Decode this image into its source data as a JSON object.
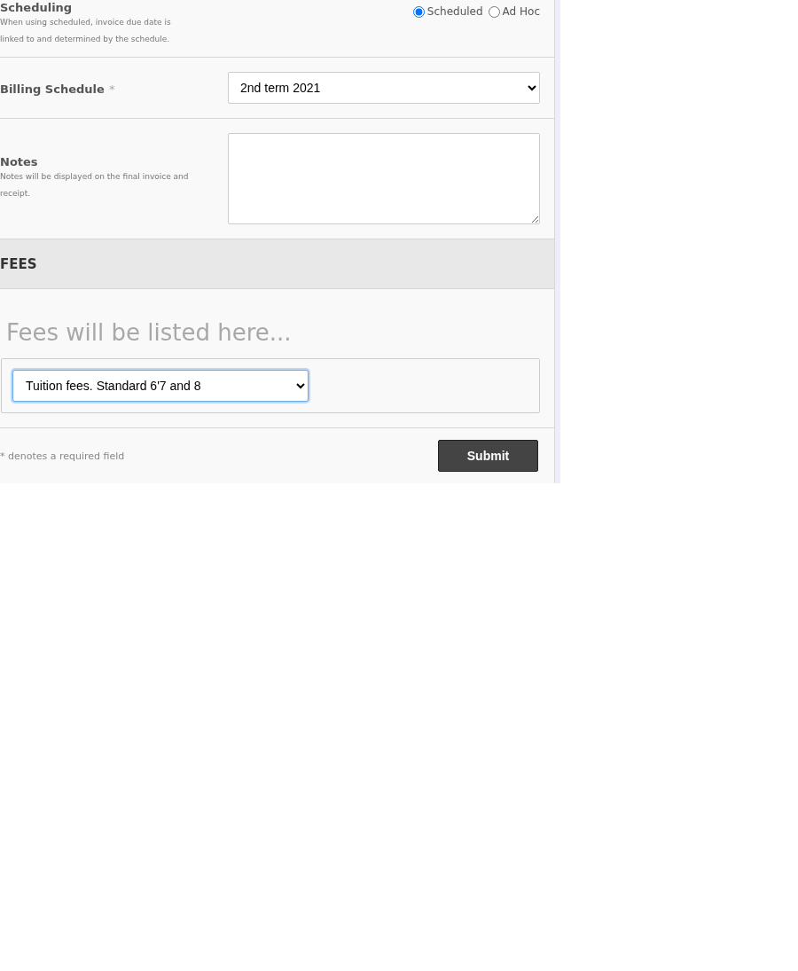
{
  "scheduling": {
    "label": "Scheduling",
    "help": "When using scheduled, invoice due date is linked to and determined by the schedule.",
    "options": [
      {
        "label": "Scheduled",
        "selected": true
      },
      {
        "label": "Ad Hoc",
        "selected": false
      }
    ]
  },
  "billing_schedule": {
    "label": "Billing Schedule",
    "required_mark": "*",
    "value": "2nd term 2021"
  },
  "notes": {
    "label": "Notes",
    "help": "Notes will be displayed on the final invoice and receipt."
  },
  "fees": {
    "title": "FEES",
    "placeholder": "Fees will be listed here...",
    "fee_select": {
      "value": "Tuition fees. Standard 6'7 and 8",
      "focused": true
    }
  },
  "footer": {
    "note": "* denotes a required field",
    "submit": "Submit"
  }
}
